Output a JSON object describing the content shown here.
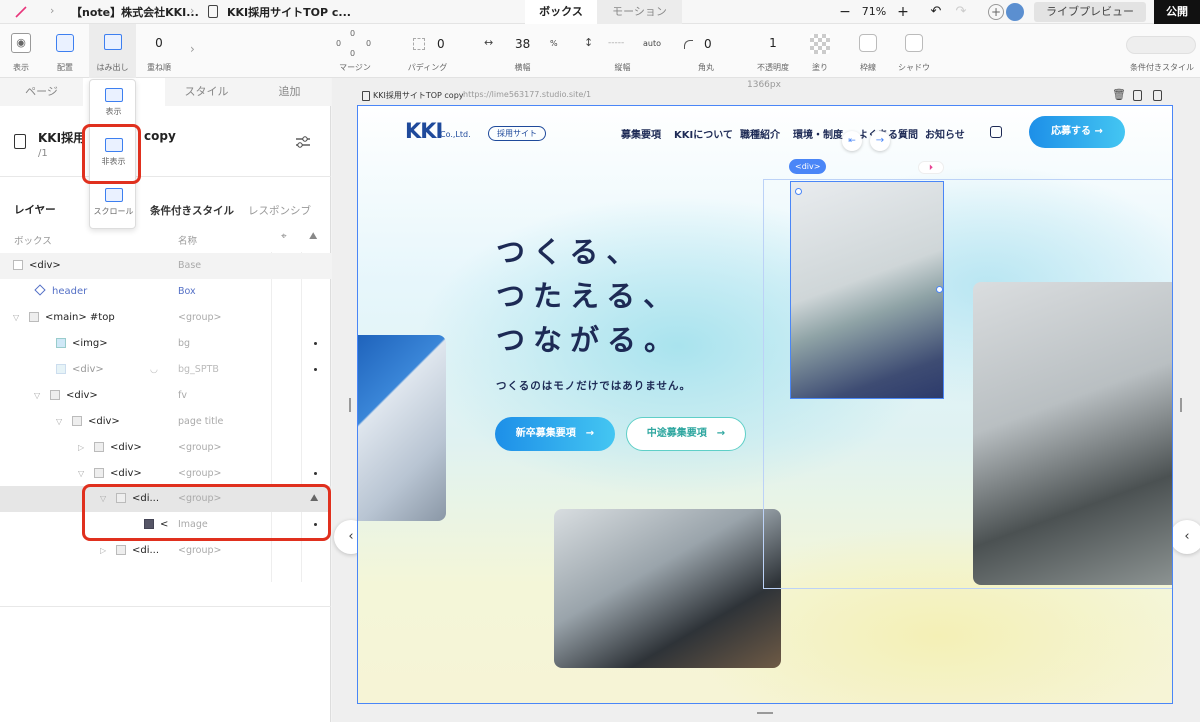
{
  "topbar": {
    "crumb1": "【note】株式会社KKI...",
    "crumb2": "KKI採用サイトTOP c...",
    "tab_box": "ボックス",
    "tab_motion": "モーション",
    "zoom": "71%",
    "zoom_minus": "−",
    "zoom_plus": "+",
    "preview": "ライブプレビュー",
    "publish": "公開"
  },
  "toolbar": {
    "display": "表示",
    "layout": "配置",
    "overflow": "はみ出し",
    "zorder": "重ね順",
    "zorder_value": "0",
    "margin": "マージン",
    "margin_top": "0",
    "margin_left": "0",
    "margin_right": "0",
    "margin_bottom": "0",
    "padding": "パディング",
    "padding_value": "0",
    "width": "横幅",
    "width_value": "38",
    "width_unit": "%",
    "height": "縦幅",
    "height_value": "-----",
    "height_unit": "auto",
    "radius": "角丸",
    "radius_value": "0",
    "opacity": "不透明度",
    "opacity_value": "1",
    "fill": "塗り",
    "border": "枠線",
    "shadow": "シャドウ",
    "conditional": "条件付きスタイル"
  },
  "popup": {
    "opt_show": "表示",
    "opt_hide": "非表示",
    "opt_scroll": "スクロール"
  },
  "leftpanel": {
    "tab_page": "ページ",
    "tab_style": "スタイル",
    "tab_add": "追加",
    "page_title": "KKI採用",
    "page_title_suffix": "copy",
    "page_path": "/1",
    "section_layer": "レイヤー",
    "section_conditional": "条件付きスタイル",
    "section_responsive": "レスポンシブ",
    "col_box": "ボックス",
    "col_name": "名称"
  },
  "layers": [
    {
      "label": "<div>",
      "name": "Base"
    },
    {
      "label": "header",
      "name": "Box"
    },
    {
      "label": "<main> #top",
      "name": "<group>"
    },
    {
      "label": "<img>",
      "name": "bg"
    },
    {
      "label": "<div>",
      "name": "bg_SPTB"
    },
    {
      "label": "<div>",
      "name": "fv"
    },
    {
      "label": "<div>",
      "name": "page title"
    },
    {
      "label": "<div>",
      "name": "<group>"
    },
    {
      "label": "<div>",
      "name": "<group>"
    },
    {
      "label": "<di...",
      "name": "<group>"
    },
    {
      "label": "<",
      "name": "Image"
    },
    {
      "label": "<di...",
      "name": "<group>"
    }
  ],
  "canvas": {
    "width_label": "1366px",
    "frame_title": "KKI採用サイトTOP copy",
    "frame_url": "https://lime563177.studio.site/1",
    "selected_tag": "<div>"
  },
  "site": {
    "logo": "KKI",
    "logo_sub": "Co.,Ltd.",
    "logo_badge": "採用サイト",
    "nav": [
      "募集要項",
      "KKIについて",
      "職種紹介",
      "環境・制度",
      "よくある質問",
      "お知らせ"
    ],
    "cta": "応募する",
    "headline_1": "つくる、",
    "headline_2": "つたえる、",
    "headline_3": "つながる。",
    "tagline": "つくるのはモノだけではありません。",
    "btn_new": "新卒募集要項",
    "btn_mid": "中途募集要項"
  },
  "colors": {
    "accent": "#4a86f7",
    "highlight": "#e0301e",
    "brand_navy": "#1d2a55",
    "gradient_start": "#1d8fe8",
    "gradient_end": "#44c6f2"
  }
}
